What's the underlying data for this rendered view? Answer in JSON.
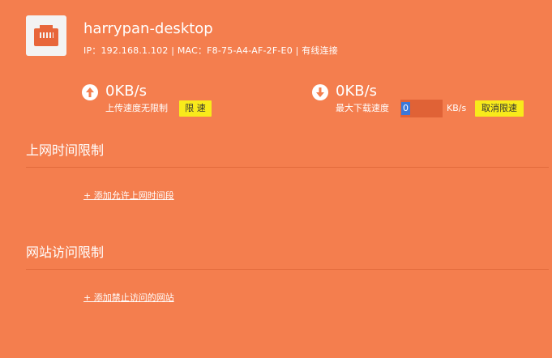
{
  "device": {
    "name": "harrypan-desktop",
    "info": "IP：192.168.1.102 | MAC：F8-75-A4-AF-2F-E0 | 有线连接",
    "icon": "ethernet-port-icon"
  },
  "upload": {
    "speed": "0KB/s",
    "label": "上传速度无限制",
    "button_label": "限 速",
    "icon": "arrow-up-circle-icon"
  },
  "download": {
    "speed": "0KB/s",
    "label": "最大下载速度",
    "limit_value": "0",
    "unit": "KB/s",
    "button_label": "取消限速",
    "icon": "arrow-down-circle-icon"
  },
  "time_limit": {
    "title": "上网时间限制",
    "add_link": "+ 添加允许上网时间段"
  },
  "site_limit": {
    "title": "网站访问限制",
    "add_link": "+ 添加禁止访问的网站"
  },
  "colors": {
    "background": "#f47e4e",
    "button": "#f8ea1b",
    "input_bg": "#e06236",
    "icon": "#e8663a"
  }
}
